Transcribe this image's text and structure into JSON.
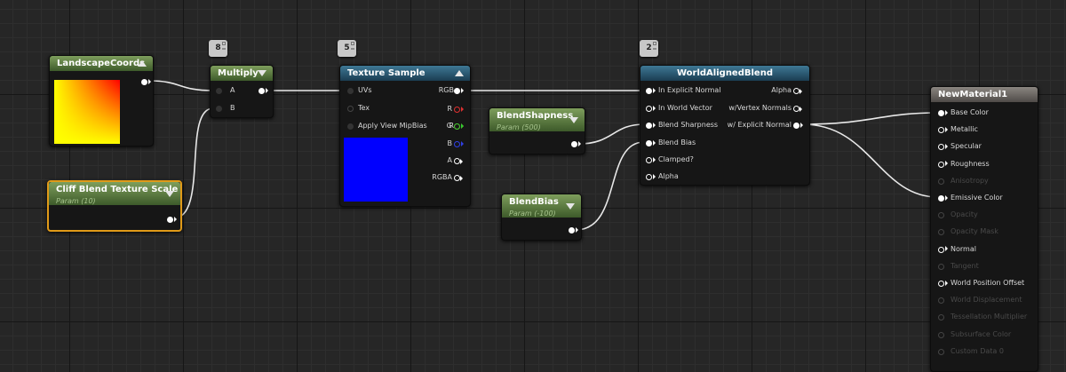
{
  "nodes": {
    "landscape_coords": {
      "title": "LandscapeCoords"
    },
    "cliff_scale": {
      "title": "Cliff Blend Texture Scale",
      "subtitle": "Param (10)"
    },
    "multiply": {
      "title": "Multiply",
      "stat": "8",
      "pin_a": "A",
      "pin_b": "B"
    },
    "texture_sample": {
      "title": "Texture Sample",
      "stat": "5",
      "inputs": [
        "UVs",
        "Tex",
        "Apply View MipBias"
      ],
      "outputs": [
        "RGB",
        "R",
        "G",
        "B",
        "A",
        "RGBA"
      ]
    },
    "blend_sharpness": {
      "title": "BlendShapness",
      "subtitle": "Param (500)"
    },
    "blend_bias": {
      "title": "BlendBias",
      "subtitle": "Param (-100)"
    },
    "world_aligned_blend": {
      "title": "WorldAlignedBlend",
      "stat": "2",
      "inputs": [
        "In Explicit Normal",
        "In World Vector",
        "Blend Sharpness",
        "Blend Bias",
        "Clamped?",
        "Alpha"
      ],
      "outputs": [
        "Alpha",
        "w/Vertex Normals",
        "w/ Explicit Normal"
      ]
    },
    "new_material": {
      "title": "NewMaterial1",
      "inputs": [
        {
          "label": "Base Color",
          "active": true,
          "connected": true
        },
        {
          "label": "Metallic",
          "active": true
        },
        {
          "label": "Specular",
          "active": true
        },
        {
          "label": "Roughness",
          "active": true
        },
        {
          "label": "Anisotropy",
          "active": false
        },
        {
          "label": "Emissive Color",
          "active": true,
          "connected": true
        },
        {
          "label": "Opacity",
          "active": false
        },
        {
          "label": "Opacity Mask",
          "active": false
        },
        {
          "label": "Normal",
          "active": true
        },
        {
          "label": "Tangent",
          "active": false
        },
        {
          "label": "World Position Offset",
          "active": true
        },
        {
          "label": "World Displacement",
          "active": false
        },
        {
          "label": "Tessellation Multiplier",
          "active": false
        },
        {
          "label": "Subsurface Color",
          "active": false
        },
        {
          "label": "Custom Data 0",
          "active": false
        }
      ]
    }
  },
  "colors": {
    "material_header": "#8a8580",
    "texture_header": "#3e7895",
    "param_header": "#7e9e5c",
    "selection": "#e09a18",
    "texture_preview": "#0000ff"
  }
}
